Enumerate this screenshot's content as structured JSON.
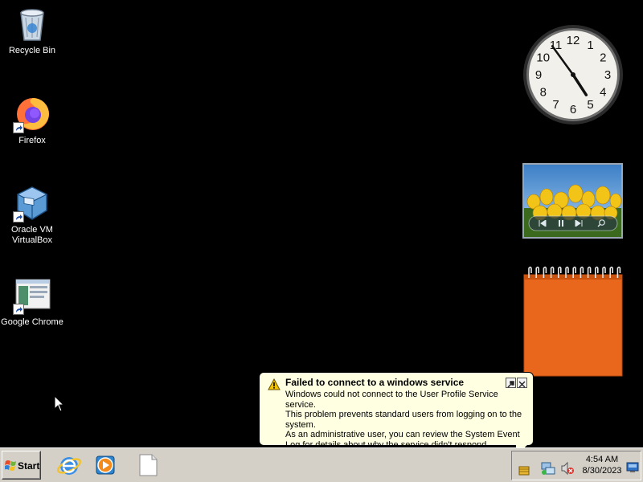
{
  "desktop": {
    "icons": [
      {
        "label": "Recycle Bin",
        "icon": "recycle-bin-icon"
      },
      {
        "label": "Firefox",
        "icon": "firefox-icon"
      },
      {
        "label": "Oracle VM VirtualBox",
        "icon": "virtualbox-icon"
      },
      {
        "label": "Google Chrome",
        "icon": "chrome-icon"
      }
    ]
  },
  "gadgets": {
    "clock": {
      "hour": 4,
      "minute": 54,
      "numerals": [
        "12",
        "1",
        "2",
        "3",
        "4",
        "5",
        "6",
        "7",
        "8",
        "9",
        "10",
        "11"
      ]
    },
    "slideshow": {
      "controls": [
        "previous-icon",
        "pause-icon",
        "next-icon",
        "zoom-icon"
      ]
    },
    "notes": {
      "color": "#e8671c"
    }
  },
  "balloon": {
    "title": "Failed to connect to a windows service",
    "line1": "Windows could not connect to the User Profile Service service.",
    "line2": "This problem prevents standard users from logging on to the",
    "line3": "system.",
    "line4": "As an administrative user, you can review the System Event",
    "line5": "Log for details about why the service didn't respond.",
    "buttons": [
      "options-icon",
      "close-icon"
    ]
  },
  "taskbar": {
    "start_label": "Start",
    "quick_launch": [
      "internet-explorer-icon",
      "media-player-icon",
      "blank-document-icon"
    ],
    "tray": {
      "time": "4:54 AM",
      "date": "8/30/2023",
      "icons": [
        "security-alert-icon",
        "network-icon",
        "volume-muted-icon",
        "show-desktop-icon"
      ]
    }
  },
  "colors": {
    "desktop": "#000000",
    "taskbar": "#d4d0c8",
    "balloon": "#ffffe1",
    "accent": "#e8671c"
  }
}
